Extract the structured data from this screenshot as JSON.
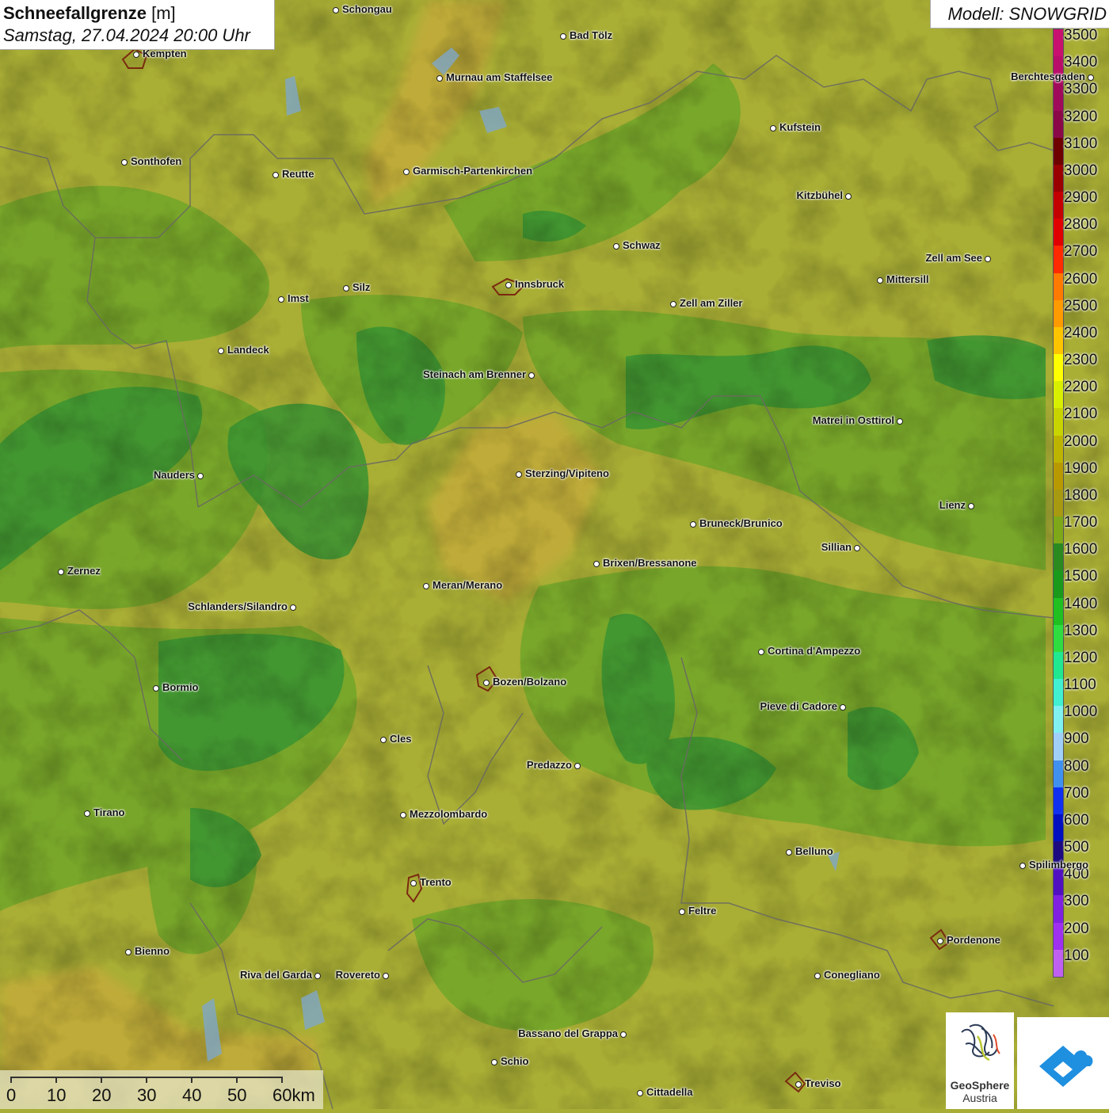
{
  "title": {
    "name": "Schneefallgrenze",
    "unit": "[m]",
    "datetime": "Samstag, 27.04.2024 20:00 Uhr"
  },
  "model_label": "Modell: SNOWGRID",
  "legend": {
    "labels": [
      "3500",
      "3400",
      "3300",
      "3200",
      "3100",
      "3000",
      "2900",
      "2800",
      "2700",
      "2600",
      "2500",
      "2400",
      "2300",
      "2200",
      "2100",
      "2000",
      "1900",
      "1800",
      "1700",
      "1600",
      "1500",
      "1400",
      "1300",
      "1200",
      "1100",
      "1000",
      "900",
      "800",
      "700",
      "600",
      "500",
      "400",
      "300",
      "200",
      "100"
    ],
    "colors": [
      "#c8106e",
      "#b80e6a",
      "#a00a5a",
      "#8a0848",
      "#6e0000",
      "#9a0000",
      "#c40000",
      "#e00000",
      "#ff2a00",
      "#ff7a00",
      "#ff9a00",
      "#ffc400",
      "#ffff00",
      "#d8f000",
      "#c8d400",
      "#bdb400",
      "#b89a00",
      "#a79a10",
      "#7ea818",
      "#2a8a20",
      "#1a9a1a",
      "#20c020",
      "#30dd40",
      "#20e890",
      "#40f0d0",
      "#80f0f0",
      "#a0d0f8",
      "#4090f0",
      "#1030f0",
      "#0010c0",
      "#1c0a80",
      "#5010c0",
      "#8020e0",
      "#a030f0",
      "#c060f0"
    ]
  },
  "cities": [
    {
      "name": "Schongau"
    },
    {
      "name": "Bad Tölz"
    },
    {
      "name": "Kempten"
    },
    {
      "name": "Murnau am Staffelsee"
    },
    {
      "name": "Kufstein"
    },
    {
      "name": "Berchtesgaden"
    },
    {
      "name": "Sonthofen"
    },
    {
      "name": "Reutte"
    },
    {
      "name": "Garmisch-Partenkirchen"
    },
    {
      "name": "Kitzbühel"
    },
    {
      "name": "Schwaz"
    },
    {
      "name": "Zell am See"
    },
    {
      "name": "Innsbruck"
    },
    {
      "name": "Mittersill"
    },
    {
      "name": "Imst"
    },
    {
      "name": "Silz"
    },
    {
      "name": "Zell am Ziller"
    },
    {
      "name": "Landeck"
    },
    {
      "name": "Steinach am Brenner"
    },
    {
      "name": "Matrei in Osttirol"
    },
    {
      "name": "Nauders"
    },
    {
      "name": "Sterzing/Vipiteno"
    },
    {
      "name": "Lienz"
    },
    {
      "name": "Bruneck/Brunico"
    },
    {
      "name": "Sillian"
    },
    {
      "name": "Zernez"
    },
    {
      "name": "Brixen/Bressanone"
    },
    {
      "name": "Meran/Merano"
    },
    {
      "name": "Schlanders/Silandro"
    },
    {
      "name": "Cortina d'Ampezzo"
    },
    {
      "name": "Bormio"
    },
    {
      "name": "Bozen/Bolzano"
    },
    {
      "name": "Pieve di Cadore"
    },
    {
      "name": "Cles"
    },
    {
      "name": "Predazzo"
    },
    {
      "name": "Tirano"
    },
    {
      "name": "Mezzolombardo"
    },
    {
      "name": "Belluno"
    },
    {
      "name": "Spilimbergo"
    },
    {
      "name": "Trento"
    },
    {
      "name": "Feltre"
    },
    {
      "name": "Pordenone"
    },
    {
      "name": "Bienno"
    },
    {
      "name": "Riva del Garda"
    },
    {
      "name": "Rovereto"
    },
    {
      "name": "Conegliano"
    },
    {
      "name": "Bassano del Grappa"
    },
    {
      "name": "Schio"
    },
    {
      "name": "Treviso"
    },
    {
      "name": "Cittadella"
    }
  ],
  "scale_bar": {
    "labels": [
      "0",
      "10",
      "20",
      "30",
      "40",
      "50",
      "60km"
    ]
  },
  "logos": {
    "geosphere_line1": "GeoSphere",
    "geosphere_line2": "Austria"
  }
}
